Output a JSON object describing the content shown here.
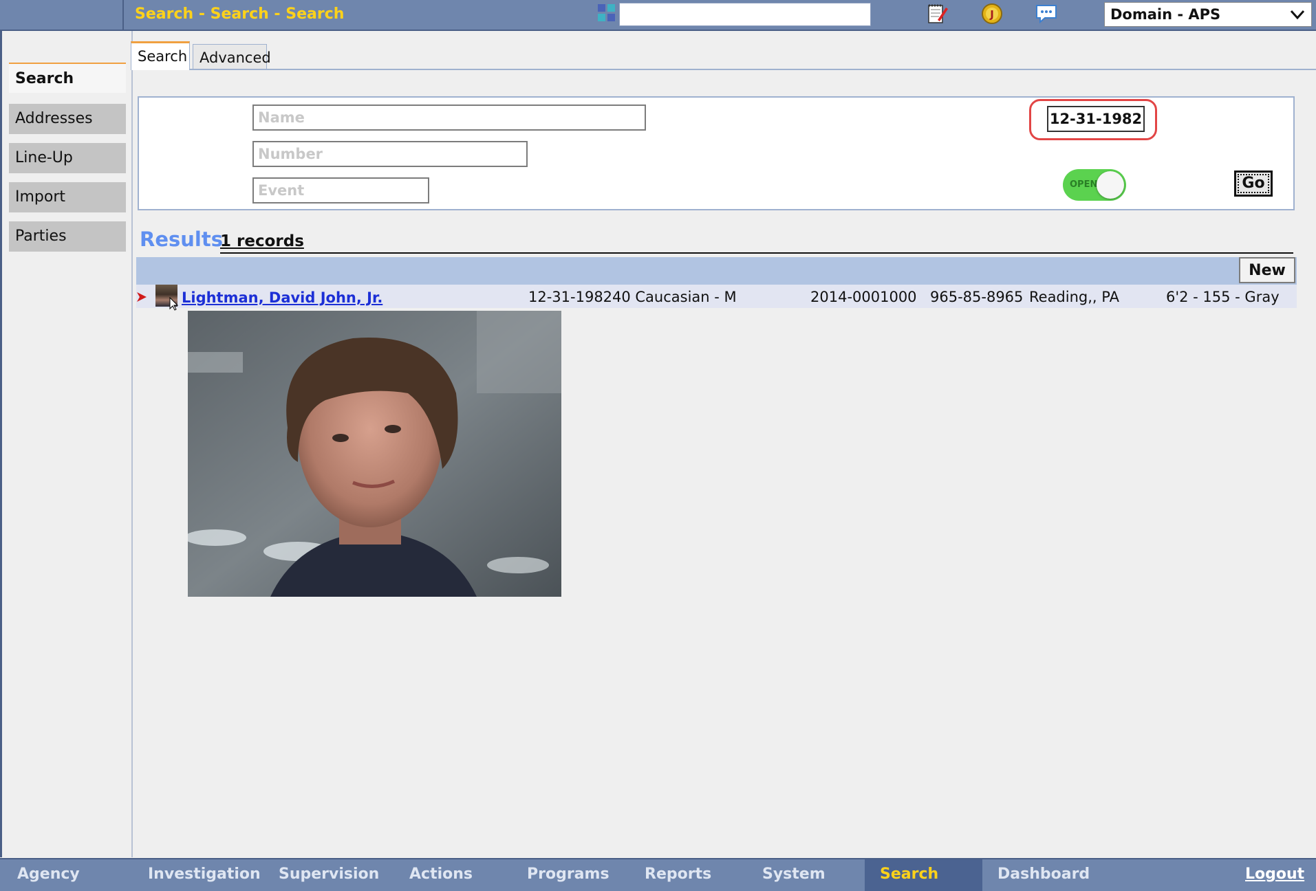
{
  "topbar": {
    "title": "Search - Search - Search",
    "search_value": "",
    "domain_selected": "Domain - APS",
    "icons": [
      "apps-icon",
      "notes-icon",
      "badge-icon",
      "chat-icon"
    ]
  },
  "sidebar": {
    "items": [
      {
        "label": "Search",
        "active": true
      },
      {
        "label": "Addresses",
        "active": false
      },
      {
        "label": "Line-Up",
        "active": false
      },
      {
        "label": "Import",
        "active": false
      },
      {
        "label": "Parties",
        "active": false
      }
    ]
  },
  "tabs": [
    {
      "label": "Search",
      "active": true
    },
    {
      "label": "Advanced",
      "active": false
    }
  ],
  "search_form": {
    "name_placeholder": "Name",
    "number_placeholder": "Number",
    "event_placeholder": "Event",
    "dob_value": "12-31-1982",
    "toggle_label": "OPEN",
    "toggle_on": true,
    "go_label": "Go"
  },
  "results": {
    "title": "Results",
    "count_label": "1 records",
    "new_label": "New",
    "rows": [
      {
        "name": "Lightman, David John, Jr.",
        "dob": "12-31-1982",
        "demographics": "40 Caucasian - M",
        "case_number": "2014-0001000",
        "ssn": "965-85-8965",
        "location": "Reading,, PA",
        "physical": "6'2 - 155 - Gray"
      }
    ]
  },
  "bottom_nav": {
    "items": [
      "Agency",
      "Investigation",
      "Supervision",
      "Actions",
      "Programs",
      "Reports",
      "System",
      "Search",
      "Dashboard"
    ],
    "active": "Search",
    "logout_label": "Logout"
  },
  "colors": {
    "bar_bg": "#6f86ad",
    "title_yellow": "#ffd21a",
    "results_blue": "#5f8ff0",
    "toggle_green": "#5bd24f",
    "highlight_red": "#e24545"
  }
}
